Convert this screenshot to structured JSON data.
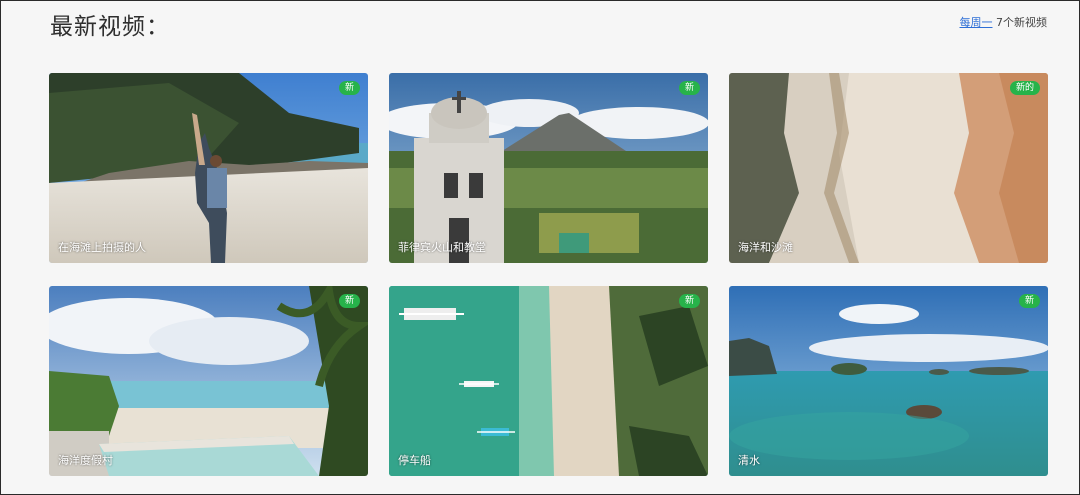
{
  "header": {
    "title": "最新视频：",
    "frequency_link": "每周一",
    "new_count_text": "7个新视频"
  },
  "videos": [
    {
      "caption": "在海滩上拍摄的人",
      "badge": "新",
      "scene": "beach-traveler"
    },
    {
      "caption": "菲律宾火山和教堂",
      "badge": "新",
      "scene": "volcano-church"
    },
    {
      "caption": "海洋和沙滩",
      "badge": "新的",
      "scene": "aerial-sand"
    },
    {
      "caption": "海洋度假村",
      "badge": "新",
      "scene": "resort-pool"
    },
    {
      "caption": "停车船",
      "badge": "新",
      "scene": "aerial-boats"
    },
    {
      "caption": "清水",
      "badge": "新",
      "scene": "clear-water"
    }
  ],
  "colors": {
    "badge": "#27b34a",
    "link": "#2f6fd6"
  }
}
